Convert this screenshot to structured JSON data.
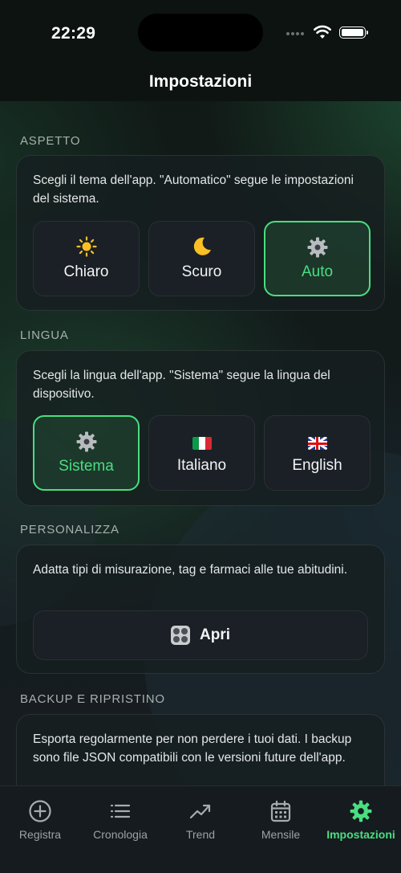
{
  "status_bar": {
    "time": "22:29"
  },
  "nav": {
    "title": "Impostazioni"
  },
  "appearance": {
    "section_title": "ASPETTO",
    "description": "Scegli il tema dell'app. \"Automatico\" segue le impostazioni del sistema.",
    "options": [
      {
        "label": "Chiaro",
        "icon": "sun-icon",
        "selected": false
      },
      {
        "label": "Scuro",
        "icon": "moon-icon",
        "selected": false
      },
      {
        "label": "Auto",
        "icon": "gear-icon",
        "selected": true
      }
    ]
  },
  "language": {
    "section_title": "LINGUA",
    "description": "Scegli la lingua dell'app. \"Sistema\" segue la lingua del dispositivo.",
    "options": [
      {
        "label": "Sistema",
        "icon": "gear-icon",
        "selected": true
      },
      {
        "label": "Italiano",
        "icon": "italy-flag-icon",
        "selected": false
      },
      {
        "label": "English",
        "icon": "uk-flag-icon",
        "selected": false
      }
    ]
  },
  "customize": {
    "section_title": "PERSONALIZZA",
    "description": "Adatta tipi di misurazione, tag e farmaci alle tue abitudini.",
    "button_label": "Apri",
    "button_icon": "apps-icon"
  },
  "backup": {
    "section_title": "BACKUP E RIPRISTINO",
    "description": "Esporta regolarmente per non perdere i tuoi dati. I backup sono file JSON compatibili con le versioni future dell'app."
  },
  "tabs": [
    {
      "label": "Registra",
      "icon": "plus-circle-icon",
      "active": false
    },
    {
      "label": "Cronologia",
      "icon": "list-icon",
      "active": false
    },
    {
      "label": "Trend",
      "icon": "trend-icon",
      "active": false
    },
    {
      "label": "Mensile",
      "icon": "calendar-icon",
      "active": false
    },
    {
      "label": "Impostazioni",
      "icon": "gear-icon",
      "active": true
    }
  ],
  "colors": {
    "accent": "#4ade80",
    "background": "#0f1714",
    "card": "#161e20",
    "tabbar": "#161b20"
  }
}
